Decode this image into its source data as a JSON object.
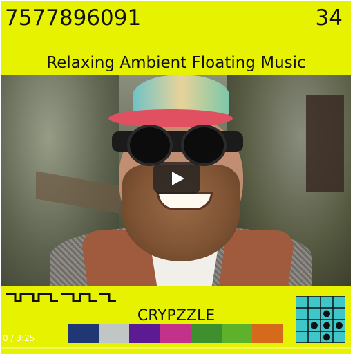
{
  "header": {
    "track_id": "7577896091",
    "track_number": "34",
    "title": "Relaxing Ambient Floating Music"
  },
  "footer": {
    "artist": "CRYPZZLE",
    "swatch_colors": [
      "#1f3873",
      "#c0c6c4",
      "#5c1b93",
      "#c2318a",
      "#3e8f2d",
      "#5eb22b",
      "#d56a1a"
    ]
  },
  "player": {
    "time": "0 / 3:25",
    "progress": 0.0
  },
  "colors": {
    "accent_yellow": "#e6f200",
    "grid_cyan": "#3ec6c9"
  },
  "icons": {
    "play": "play-icon",
    "logo_grid": "dot-grid-logo-icon",
    "squiggle": "square-wave-glyph-icon"
  }
}
